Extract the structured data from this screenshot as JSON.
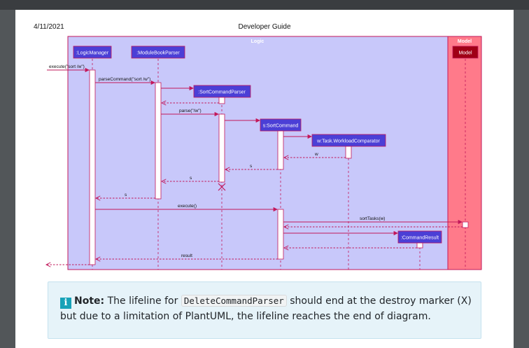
{
  "page_header": {
    "date": "4/11/2021",
    "title": "Developer Guide"
  },
  "diagram": {
    "frames": {
      "logic": "Logic",
      "model": "Model"
    },
    "participants": {
      "logic_manager": ":LogicManager",
      "module_book_parser": ":ModuleBookParser",
      "sort_command_parser": ":SortCommandParser",
      "sort_command": "s:SortCommand",
      "workload_comparator": "w:Task.WorkloadComparator",
      "command_result": ":CommandResult",
      "model": "Model"
    },
    "messages": {
      "execute_in": "execute(\"sort /w\")",
      "parse_command": "parseCommand(\"sort /w\")",
      "parse": "parse(\"/w\")",
      "w_return": "w",
      "s_return_1": "s",
      "s_return_2": "s",
      "s_return_3": "s",
      "execute": "execute()",
      "sort_tasks": "sortTasks(w)",
      "result": "result"
    },
    "colors": {
      "logic_frame": "#c8c8fa",
      "model_frame": "#ff7a8a",
      "participant": "#4b3fd6",
      "model_box": "#a00016",
      "arrow": "#c2185b"
    }
  },
  "note": {
    "icon": "info-icon",
    "label": "Note:",
    "text_before": " The lifeline for ",
    "code": "DeleteCommandParser",
    "text_after": " should end at the destroy marker (X) but due to a limitation of PlantUML, the lifeline reaches the end of diagram."
  }
}
